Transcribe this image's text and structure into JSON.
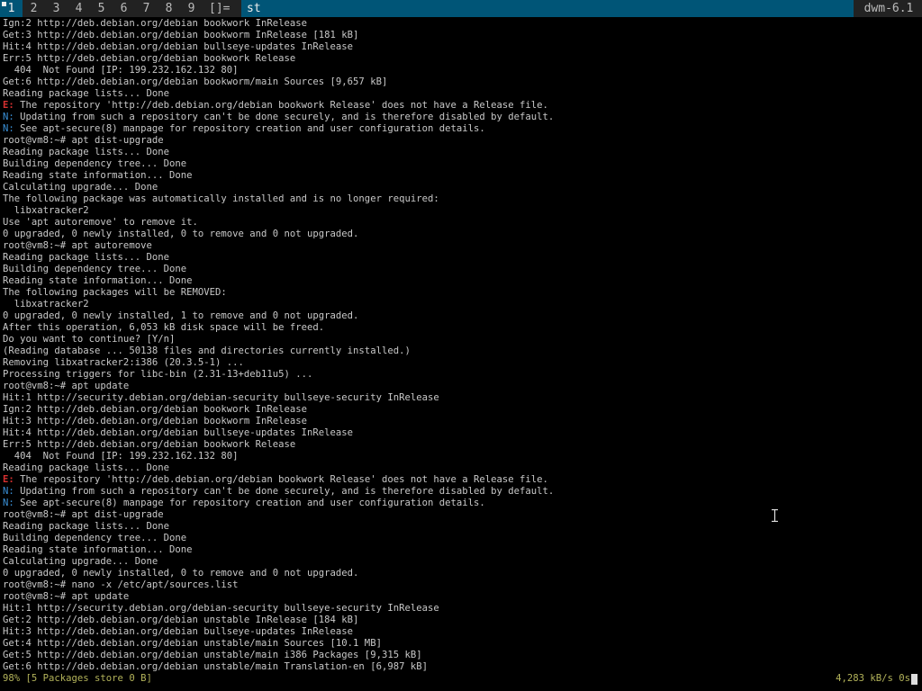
{
  "bar": {
    "tags": [
      {
        "label": "1",
        "selected": true,
        "occupied": true
      },
      {
        "label": "2",
        "selected": false,
        "occupied": false
      },
      {
        "label": "3",
        "selected": false,
        "occupied": false
      },
      {
        "label": "4",
        "selected": false,
        "occupied": false
      },
      {
        "label": "5",
        "selected": false,
        "occupied": false
      },
      {
        "label": "6",
        "selected": false,
        "occupied": false
      },
      {
        "label": "7",
        "selected": false,
        "occupied": false
      },
      {
        "label": "8",
        "selected": false,
        "occupied": false
      },
      {
        "label": "9",
        "selected": false,
        "occupied": false
      }
    ],
    "layout_symbol": "[]=",
    "window_title": "st",
    "status_text": "dwm-6.1",
    "colors": {
      "bar_bg": "#222222",
      "selected_bg": "#005577",
      "selected_fg": "#eeeeee",
      "normal_fg": "#bbbbbb"
    }
  },
  "terminal": {
    "lines": [
      "Ign:2 http://deb.debian.org/debian bookwork InRelease",
      "Get:3 http://deb.debian.org/debian bookworm InRelease [181 kB]",
      "Hit:4 http://deb.debian.org/debian bullseye-updates InRelease",
      "Err:5 http://deb.debian.org/debian bookwork Release",
      "  404  Not Found [IP: 199.232.162.132 80]",
      "Get:6 http://deb.debian.org/debian bookworm/main Sources [9,657 kB]",
      "Reading package lists... Done",
      "E: The repository 'http://deb.debian.org/debian bookwork Release' does not have a Release file.",
      "N: Updating from such a repository can't be done securely, and is therefore disabled by default.",
      "N: See apt-secure(8) manpage for repository creation and user configuration details.",
      "root@vm8:~# apt dist-upgrade",
      "Reading package lists... Done",
      "Building dependency tree... Done",
      "Reading state information... Done",
      "Calculating upgrade... Done",
      "The following package was automatically installed and is no longer required:",
      "  libxatracker2",
      "Use 'apt autoremove' to remove it.",
      "0 upgraded, 0 newly installed, 0 to remove and 0 not upgraded.",
      "root@vm8:~# apt autoremove",
      "Reading package lists... Done",
      "Building dependency tree... Done",
      "Reading state information... Done",
      "The following packages will be REMOVED:",
      "  libxatracker2",
      "0 upgraded, 0 newly installed, 1 to remove and 0 not upgraded.",
      "After this operation, 6,053 kB disk space will be freed.",
      "Do you want to continue? [Y/n]",
      "(Reading database ... 50138 files and directories currently installed.)",
      "Removing libxatracker2:i386 (20.3.5-1) ...",
      "Processing triggers for libc-bin (2.31-13+deb11u5) ...",
      "root@vm8:~# apt update",
      "Hit:1 http://security.debian.org/debian-security bullseye-security InRelease",
      "Ign:2 http://deb.debian.org/debian bookwork InRelease",
      "Hit:3 http://deb.debian.org/debian bookworm InRelease",
      "Hit:4 http://deb.debian.org/debian bullseye-updates InRelease",
      "Err:5 http://deb.debian.org/debian bookwork Release",
      "  404  Not Found [IP: 199.232.162.132 80]",
      "Reading package lists... Done",
      "E: The repository 'http://deb.debian.org/debian bookwork Release' does not have a Release file.",
      "N: Updating from such a repository can't be done securely, and is therefore disabled by default.",
      "N: See apt-secure(8) manpage for repository creation and user configuration details.",
      "root@vm8:~# apt dist-upgrade",
      "Reading package lists... Done",
      "Building dependency tree... Done",
      "Reading state information... Done",
      "Calculating upgrade... Done",
      "0 upgraded, 0 newly installed, 0 to remove and 0 not upgraded.",
      "root@vm8:~# nano -x /etc/apt/sources.list",
      "root@vm8:~# apt update",
      "Hit:1 http://security.debian.org/debian-security bullseye-security InRelease",
      "Get:2 http://deb.debian.org/debian unstable InRelease [184 kB]",
      "Hit:3 http://deb.debian.org/debian bullseye-updates InRelease",
      "Get:4 http://deb.debian.org/debian unstable/main Sources [10.1 MB]",
      "Get:5 http://deb.debian.org/debian unstable/main i386 Packages [9,315 kB]",
      "Get:6 http://deb.debian.org/debian unstable/main Translation-en [6,987 kB]"
    ],
    "progress_line": "98% [5 Packages store 0 B]",
    "download_rate": "4,283 kB/s 0s",
    "colors": {
      "background": "#000000",
      "foreground": "#c8c8c8",
      "notice": "#3a8fd6",
      "error": "#d63030",
      "progress": "#b3b35a"
    }
  },
  "icons": {
    "cursor": "block-cursor-icon",
    "mouse": "ibeam-cursor-icon"
  }
}
